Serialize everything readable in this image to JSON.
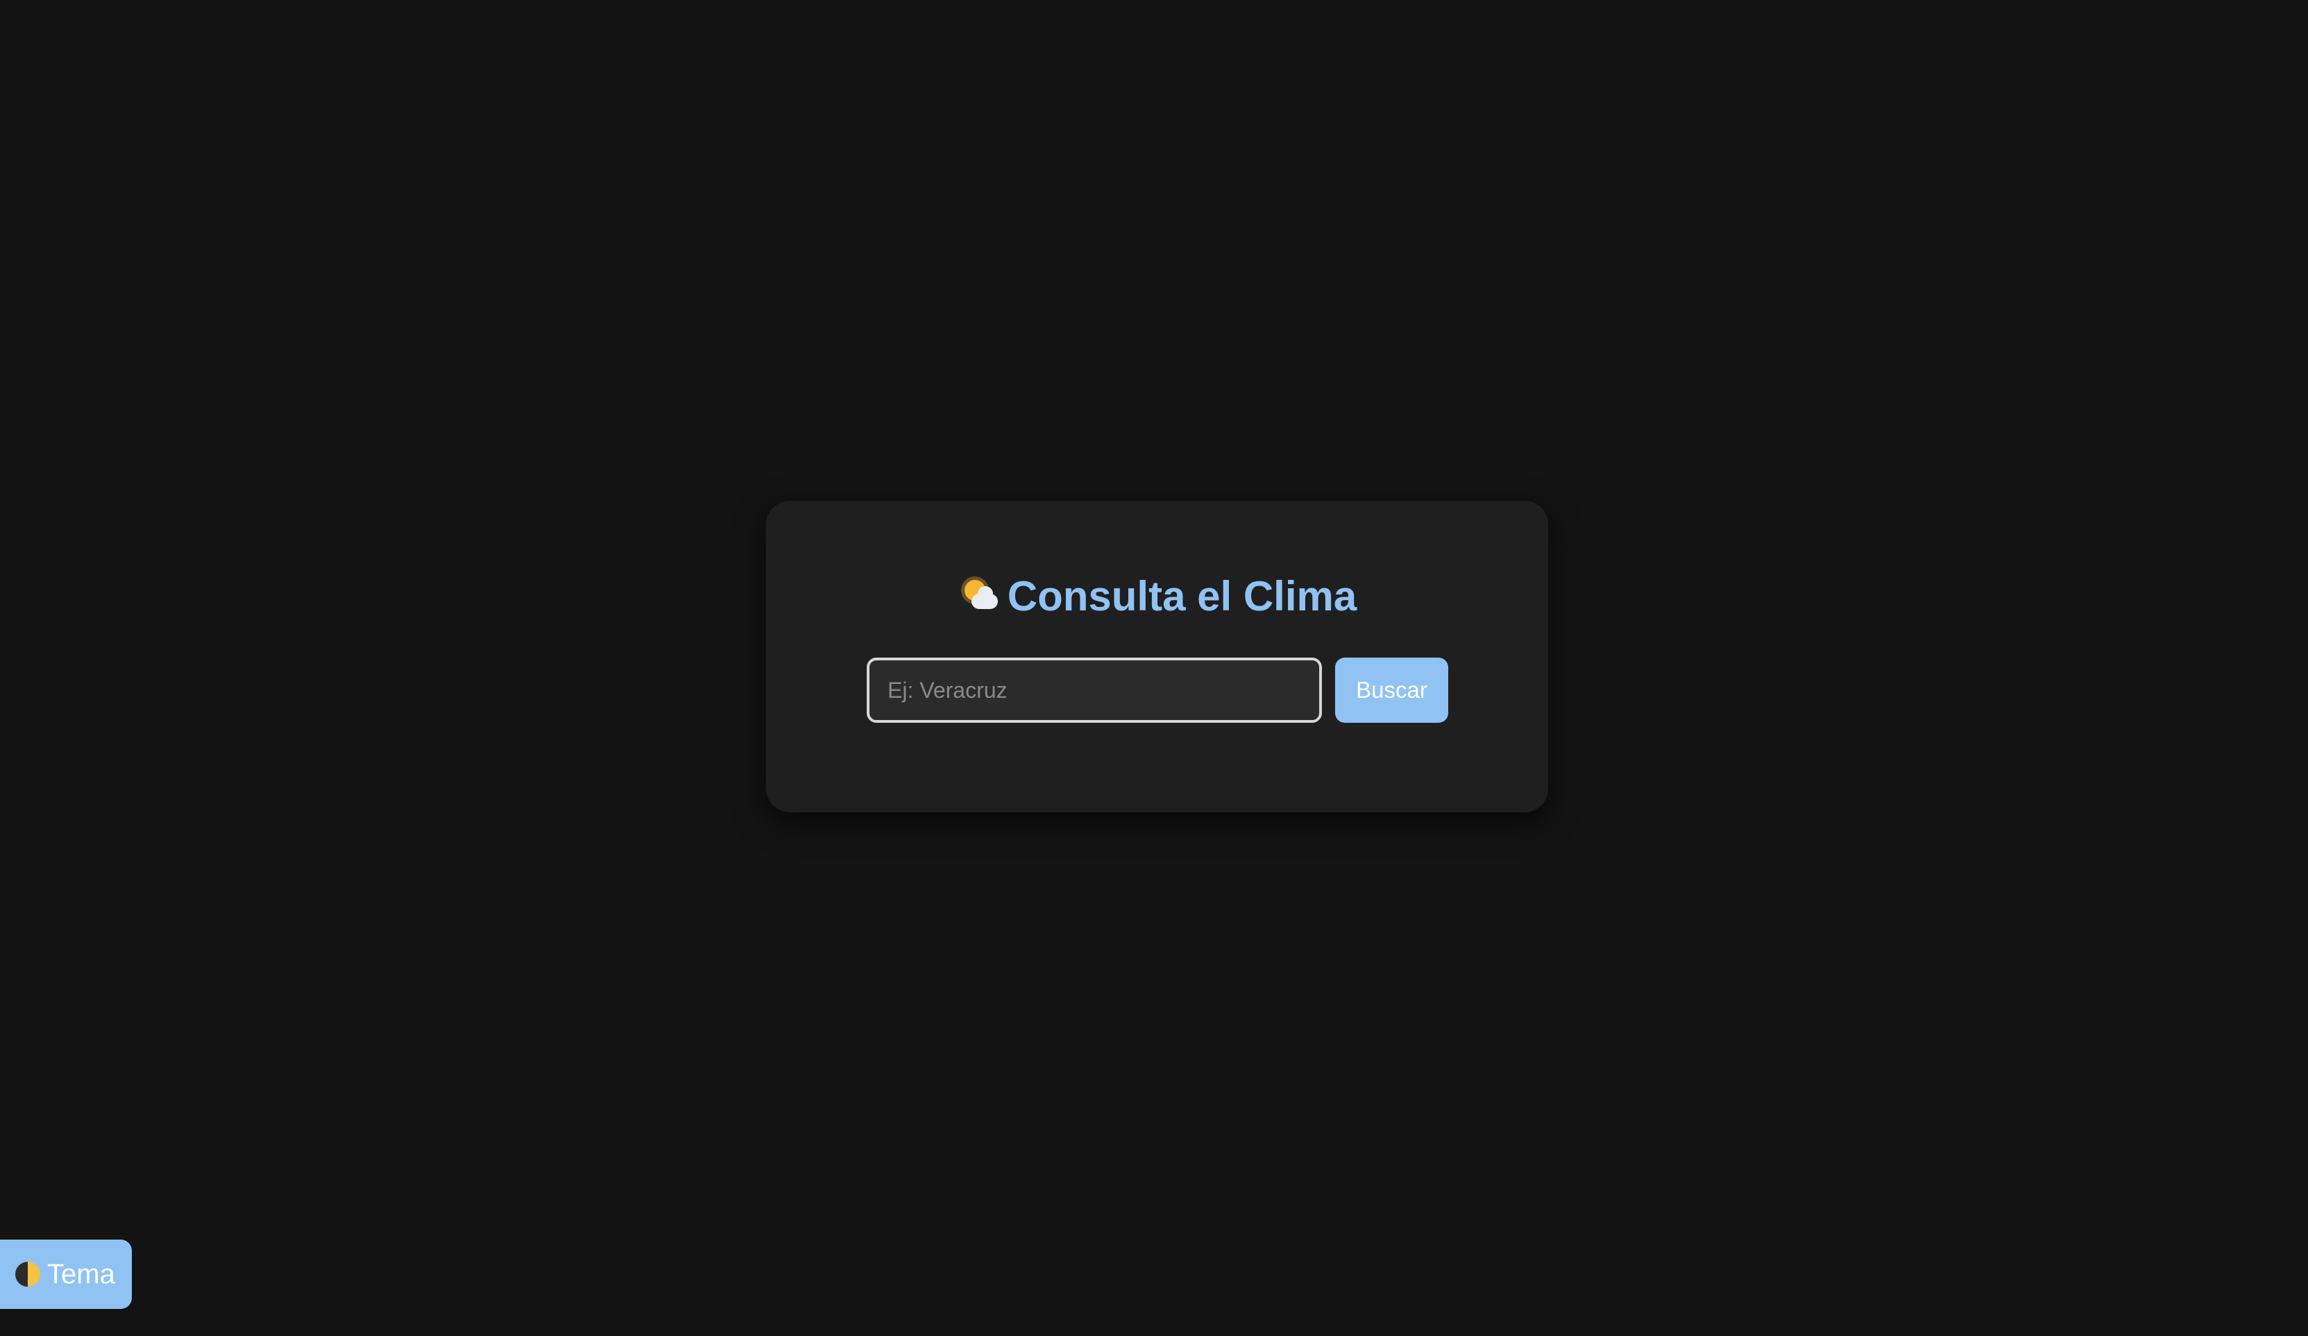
{
  "card": {
    "title_icon": "sun-behind-cloud-icon",
    "title": "Consulta el Clima"
  },
  "search": {
    "placeholder": "Ej: Veracruz",
    "value": "",
    "button_label": "Buscar"
  },
  "theme_toggle": {
    "icon": "half-moon-icon",
    "label": "Tema"
  },
  "colors": {
    "background": "#131313",
    "card": "#1f1f1f",
    "accent": "#90c2f3"
  }
}
